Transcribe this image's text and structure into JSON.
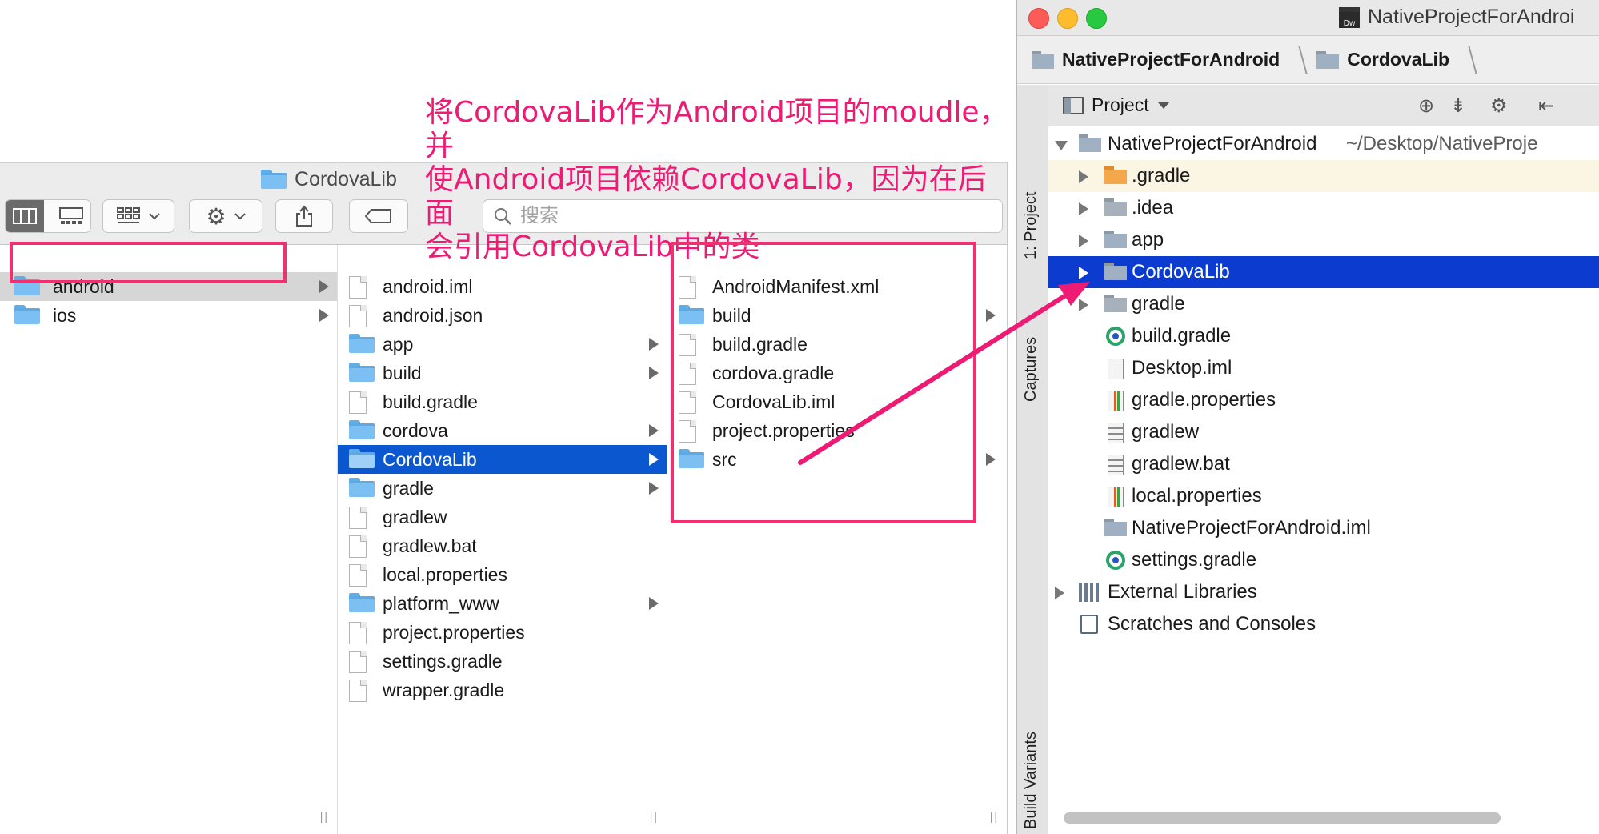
{
  "annotation": {
    "line1": "将CordovaLib作为Android项目的moudle，并",
    "line2": "使Android项目依赖CordovaLib，因为在后面",
    "line3": "会引用CordovaLib中的类"
  },
  "finder": {
    "title": "CordovaLib",
    "search_placeholder": "搜索",
    "col1": [
      "android",
      "ios"
    ],
    "col2": [
      "android.iml",
      "android.json",
      "app",
      "build",
      "build.gradle",
      "cordova",
      "CordovaLib",
      "gradle",
      "gradlew",
      "gradlew.bat",
      "local.properties",
      "platform_www",
      "project.properties",
      "settings.gradle",
      "wrapper.gradle"
    ],
    "col3": [
      "AndroidManifest.xml",
      "build",
      "build.gradle",
      "cordova.gradle",
      "CordovaLib.iml",
      "project.properties",
      "src"
    ]
  },
  "ide": {
    "window_title": "NativeProjectForAndroi",
    "dw_badge": "Dw",
    "breadcrumb": [
      "NativeProjectForAndroid",
      "CordovaLib"
    ],
    "side_tabs": [
      "1: Project",
      "Captures",
      "Build Variants"
    ],
    "panel_title": "Project",
    "root": {
      "label": "NativeProjectForAndroid",
      "path": "~/Desktop/NativeProje"
    },
    "tree": [
      ".gradle",
      ".idea",
      "app",
      "CordovaLib",
      "gradle",
      "build.gradle",
      "Desktop.iml",
      "gradle.properties",
      "gradlew",
      "gradlew.bat",
      "local.properties",
      "NativeProjectForAndroid.iml",
      "settings.gradle"
    ],
    "external_libraries": "External Libraries",
    "scratches": "Scratches and Consoles"
  },
  "colors": {
    "accent_pink": "#ee1b74",
    "finder_selection": "#0b57d0",
    "ide_selection": "#0b3ccf"
  }
}
